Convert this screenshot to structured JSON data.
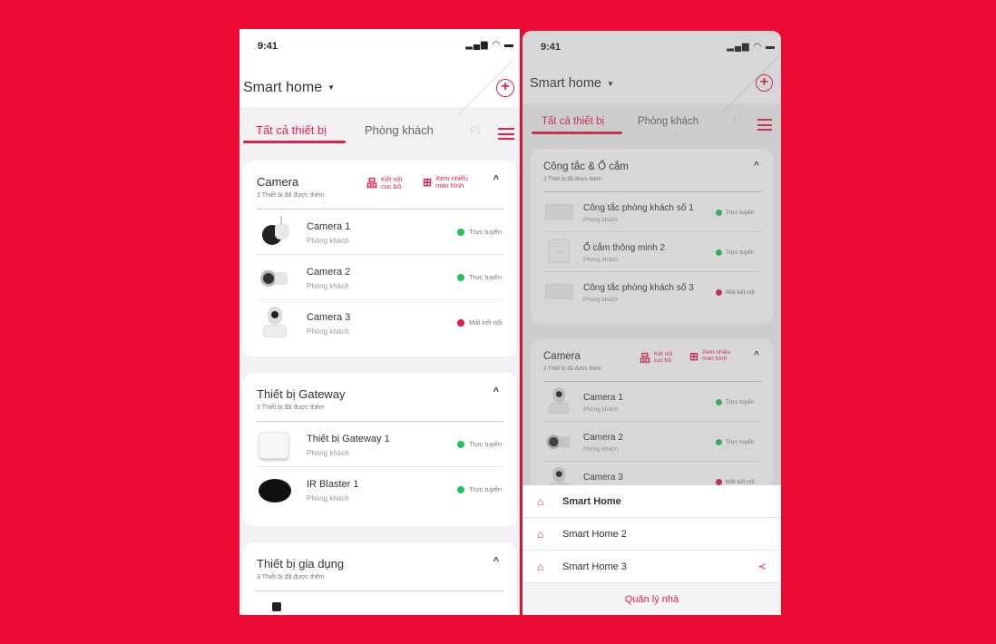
{
  "colors": {
    "background": "#ea0a33",
    "accent": "#e61e4d",
    "online": "#22c35a",
    "offline": "#e6194b"
  },
  "left": {
    "status_time": "9:41",
    "title": "Smart home",
    "tabs": [
      "Tất cả thiết bị",
      "Phòng khách",
      "Pl"
    ],
    "cards": [
      {
        "title": "Camera",
        "subtitle": "3 Thiết bị đã được thêm",
        "actions": [
          {
            "icon": "network-icon",
            "label": "Kết nối\ncục bộ"
          },
          {
            "icon": "multi-screen-icon",
            "label": "Xem nhiều\nmàn hình"
          }
        ],
        "devices": [
          {
            "name": "Camera 1",
            "room": "Phòng khách",
            "status": "Trực tuyến",
            "online": true,
            "image": "camera-bullet"
          },
          {
            "name": "Camera 2",
            "room": "Phòng khách",
            "status": "Trực tuyến",
            "online": true,
            "image": "camera-side"
          },
          {
            "name": "Camera 3",
            "room": "Phòng khách",
            "status": "Mất kết nối",
            "online": false,
            "image": "camera-dome"
          }
        ]
      },
      {
        "title": "Thiết bị Gateway",
        "subtitle": "3 Thiết bị đã được thêm",
        "actions": [],
        "devices": [
          {
            "name": "Thiết bị Gateway 1",
            "room": "Phòng khách",
            "status": "Trực tuyến",
            "online": true,
            "image": "gateway"
          },
          {
            "name": "IR Blaster 1",
            "room": "Phòng khách",
            "status": "Trực tuyến",
            "online": true,
            "image": "ir-blaster"
          }
        ]
      },
      {
        "title": "Thiết bị gia dụng",
        "subtitle": "3 Thiết bị đã được thêm",
        "actions": [],
        "devices": []
      }
    ]
  },
  "right": {
    "status_time": "9:41",
    "title": "Smart home",
    "tabs": [
      "Tất cả thiết bị",
      "Phòng khách",
      "Pl"
    ],
    "cards": [
      {
        "title": "Công tắc & Ổ cắm",
        "subtitle": "3 Thiết bị đã được thêm",
        "actions": [],
        "devices": [
          {
            "name": "Công tắc phòng khách số 1",
            "room": "Phòng khách",
            "status": "Trực tuyến",
            "online": true,
            "image": "switch"
          },
          {
            "name": "Ổ cắm thông minh 2",
            "room": "Phòng khách",
            "status": "Trực tuyến",
            "online": true,
            "image": "plug"
          },
          {
            "name": "Công tắc phòng khách số 3",
            "room": "Phòng khách",
            "status": "Mất kết nối",
            "online": false,
            "image": "switch"
          }
        ]
      },
      {
        "title": "Camera",
        "subtitle": "3 Thiết bị đã được thêm",
        "actions": [
          {
            "icon": "network-icon",
            "label": "Kết nối\ncục bộ"
          },
          {
            "icon": "multi-screen-icon",
            "label": "Xem nhiều\nmàn hình"
          }
        ],
        "devices": [
          {
            "name": "Camera 1",
            "room": "Phòng khách",
            "status": "Trực tuyến",
            "online": true,
            "image": "camera-dome"
          },
          {
            "name": "Camera 2",
            "room": "Phòng khách",
            "status": "Trực tuyến",
            "online": true,
            "image": "camera-side"
          },
          {
            "name": "Camera 3",
            "room": "Phòng khách",
            "status": "Mất kết nối",
            "online": false,
            "image": "camera-dome"
          }
        ]
      }
    ],
    "sheet": {
      "homes": [
        {
          "label": "Smart Home",
          "selected": true,
          "share": false
        },
        {
          "label": "Smart Home 2",
          "selected": false,
          "share": false
        },
        {
          "label": "Smart Home 3",
          "selected": false,
          "share": true
        }
      ],
      "manage_label": "Quản lý nhà"
    }
  }
}
